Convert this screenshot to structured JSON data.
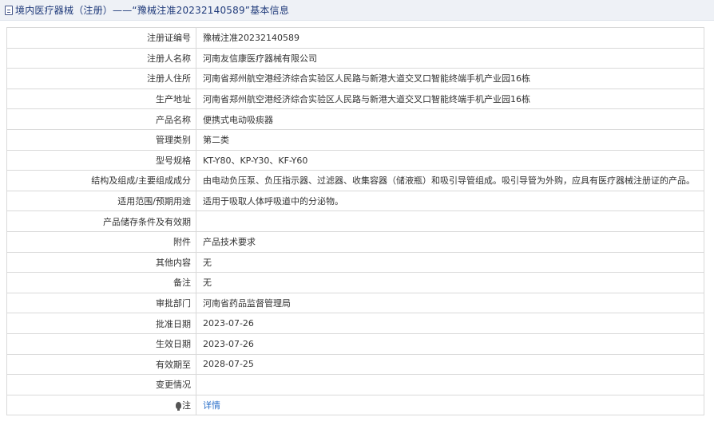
{
  "header": {
    "title": "境内医疗器械（注册）——“豫械注准20232140589”基本信息",
    "icon": "document-icon"
  },
  "rows": [
    {
      "key": "reg-number",
      "label": "注册证编号",
      "value": "豫械注准20232140589"
    },
    {
      "key": "registrant-name",
      "label": "注册人名称",
      "value": "河南友信康医疗器械有限公司"
    },
    {
      "key": "registrant-address",
      "label": "注册人住所",
      "value": "河南省郑州航空港经济综合实验区人民路与新港大道交叉口智能终端手机产业园16栋"
    },
    {
      "key": "production-address",
      "label": "生产地址",
      "value": "河南省郑州航空港经济综合实验区人民路与新港大道交叉口智能终端手机产业园16栋"
    },
    {
      "key": "product-name",
      "label": "产品名称",
      "value": "便携式电动吸痰器"
    },
    {
      "key": "management-class",
      "label": "管理类别",
      "value": "第二类"
    },
    {
      "key": "model-spec",
      "label": "型号规格",
      "value": "KT-Y80、KP-Y30、KF-Y60"
    },
    {
      "key": "structure",
      "label": "结构及组成/主要组成成分",
      "value": "由电动负压泵、负压指示器、过滤器、收集容器（储液瓶）和吸引导管组成。吸引导管为外购，应具有医疗器械注册证的产品。"
    },
    {
      "key": "scope",
      "label": "适用范围/预期用途",
      "value": "适用于吸取人体呼吸道中的分泌物。"
    },
    {
      "key": "storage",
      "label": "产品储存条件及有效期",
      "value": ""
    },
    {
      "key": "attachment",
      "label": "附件",
      "value": "产品技术要求"
    },
    {
      "key": "other",
      "label": "其他内容",
      "value": "无"
    },
    {
      "key": "remarks",
      "label": "备注",
      "value": "无"
    },
    {
      "key": "approval-dept",
      "label": "审批部门",
      "value": "河南省药品监督管理局"
    },
    {
      "key": "approval-date",
      "label": "批准日期",
      "value": "2023-07-26"
    },
    {
      "key": "effective-date",
      "label": "生效日期",
      "value": "2023-07-26"
    },
    {
      "key": "expiry-date",
      "label": "有效期至",
      "value": "2028-07-25"
    },
    {
      "key": "changes",
      "label": "变更情况",
      "value": ""
    }
  ],
  "note_row": {
    "label": "注",
    "icon": "lightbulb-icon",
    "link_text": "详情"
  },
  "colors": {
    "header_bg": "#eef1f6",
    "title_text": "#1f3a7a",
    "border": "#d9d9d9",
    "link": "#2a6fc9"
  }
}
